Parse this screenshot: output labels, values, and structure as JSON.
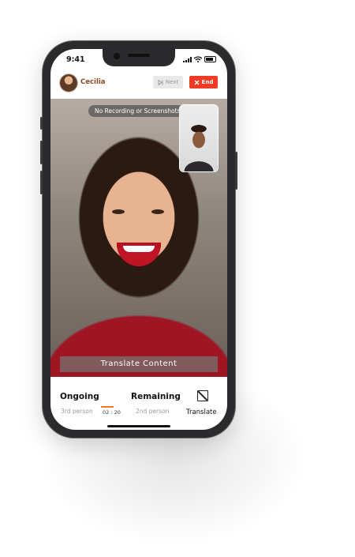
{
  "status_bar": {
    "time": "9:41"
  },
  "call": {
    "contact_name": "Cecilia",
    "next_label": "Next",
    "end_label": "End",
    "notice": "No Recording or Screenshots",
    "translate_banner": "Translate Content"
  },
  "footer": {
    "ongoing_title": "Ongoing",
    "ongoing_sub": "3rd person",
    "timer": "02 : 20",
    "remaining_title": "Remaining",
    "remaining_sub": "2nd person",
    "translate_label": "Translate"
  },
  "colors": {
    "accent": "#f03b24",
    "timer_accent": "#f07a2a",
    "name": "#8a4a22"
  },
  "icons": [
    "next-icon",
    "close-icon",
    "translate-icon",
    "wifi-icon",
    "signal-icon",
    "battery-icon"
  ]
}
